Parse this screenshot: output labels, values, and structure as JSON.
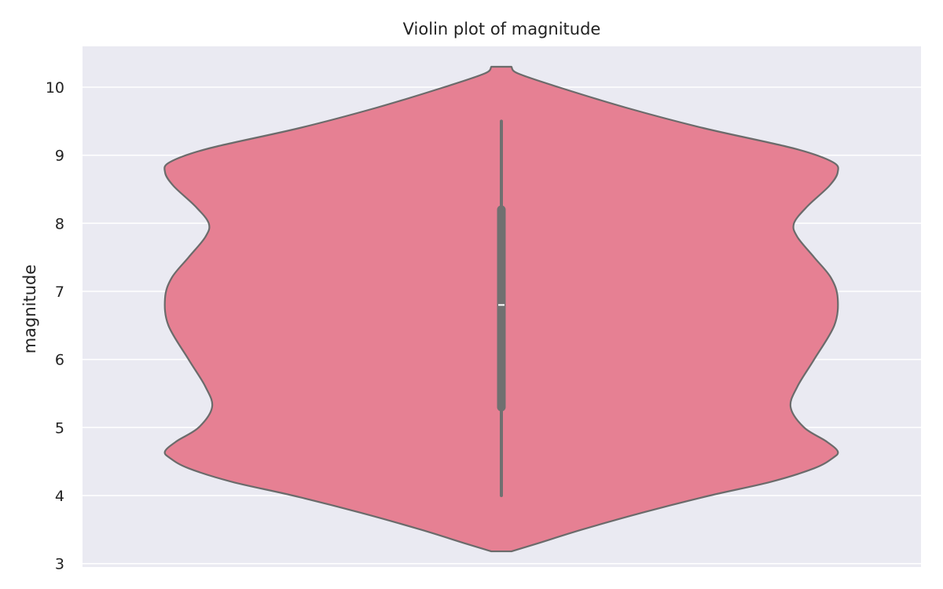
{
  "chart_data": {
    "type": "violin",
    "title": "Violin plot of magnitude",
    "xlabel": "",
    "ylabel": "magnitude",
    "ylim": [
      2.95,
      10.6
    ],
    "yticks": [
      3,
      4,
      5,
      6,
      7,
      8,
      9,
      10
    ],
    "grid": true,
    "colors": {
      "background": "#EAEAF2",
      "grid": "#FFFFFF",
      "violin_fill": "#E68093",
      "violin_edge": "#6B6B6B",
      "box": "#707070",
      "median": "#FFFFFF"
    },
    "violin": {
      "range": [
        3.18,
        10.3
      ],
      "density_profile": [
        [
          3.18,
          0.03
        ],
        [
          3.3,
          0.11
        ],
        [
          3.5,
          0.24
        ],
        [
          3.75,
          0.42
        ],
        [
          4.0,
          0.62
        ],
        [
          4.2,
          0.8
        ],
        [
          4.4,
          0.93
        ],
        [
          4.55,
          0.985
        ],
        [
          4.65,
          1.0
        ],
        [
          4.8,
          0.965
        ],
        [
          5.0,
          0.9
        ],
        [
          5.3,
          0.86
        ],
        [
          5.6,
          0.88
        ],
        [
          6.0,
          0.93
        ],
        [
          6.5,
          0.99
        ],
        [
          6.9,
          1.0
        ],
        [
          7.2,
          0.98
        ],
        [
          7.5,
          0.93
        ],
        [
          7.8,
          0.88
        ],
        [
          8.0,
          0.87
        ],
        [
          8.25,
          0.91
        ],
        [
          8.55,
          0.975
        ],
        [
          8.75,
          1.0
        ],
        [
          8.9,
          0.985
        ],
        [
          9.1,
          0.87
        ],
        [
          9.4,
          0.6
        ],
        [
          9.7,
          0.37
        ],
        [
          10.0,
          0.17
        ],
        [
          10.2,
          0.05
        ],
        [
          10.3,
          0.03
        ]
      ],
      "box": {
        "whisker_low": 4.0,
        "q1": 5.3,
        "median": 6.8,
        "q3": 8.2,
        "whisker_high": 9.5
      }
    }
  }
}
